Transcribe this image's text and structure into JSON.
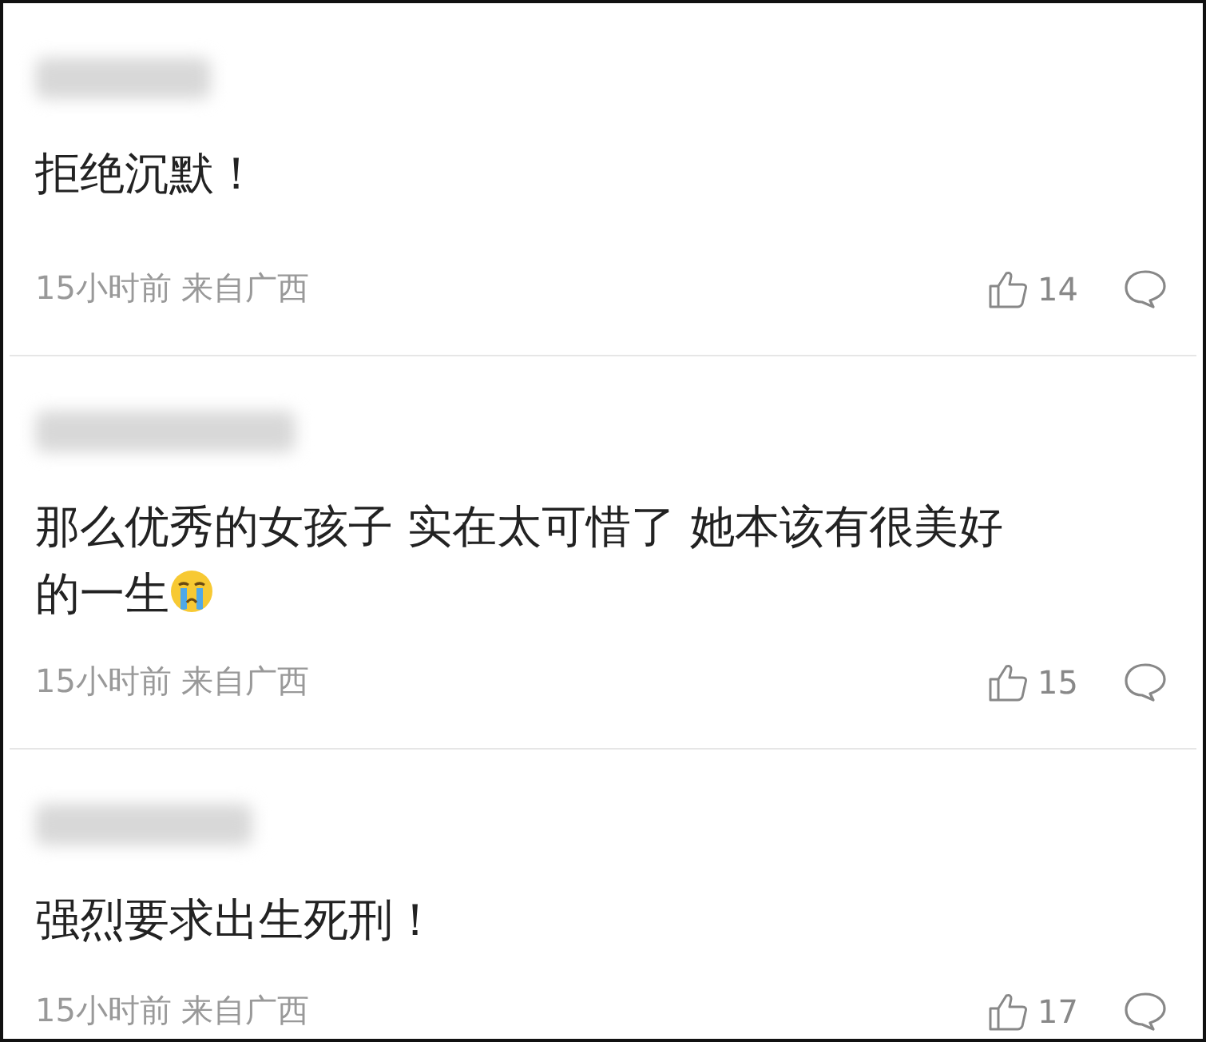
{
  "comments": [
    {
      "text": "拒绝沉默！",
      "emoji": false,
      "time": "15小时前",
      "location": "来自广西",
      "likes": "14"
    },
    {
      "text": "那么优秀的女孩子 实在太可惜了 她本该有很美好的一生",
      "emoji": true,
      "time": "15小时前",
      "location": "来自广西",
      "likes": "15"
    },
    {
      "text": "强烈要求出生死刑！",
      "emoji": false,
      "time": "15小时前",
      "location": "来自广西",
      "likes": "17"
    }
  ]
}
